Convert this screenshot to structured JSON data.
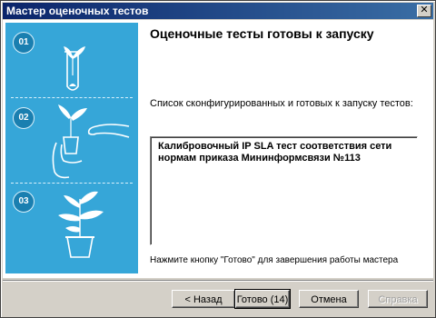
{
  "window": {
    "title": "Мастер оценочных тестов",
    "close_glyph": "✕"
  },
  "sidebar": {
    "steps": [
      {
        "number": "01",
        "icon": "test-tube-sprout-icon"
      },
      {
        "number": "02",
        "icon": "hand-planting-icon"
      },
      {
        "number": "03",
        "icon": "potted-plant-icon"
      }
    ],
    "colors": {
      "panel": "#36a6d8",
      "badge": "#1a7fb0",
      "line": "#d8f0fb"
    }
  },
  "main": {
    "heading": "Оценочные тесты готовы к запуску",
    "list_label": "Список сконфигурированных и готовых к запуску тестов:",
    "tests": [
      "Калибровочный IP SLA тест соответствия сети нормам приказа Мининформсвязи №113"
    ],
    "finish_text": "Нажмите кнопку \"Готово\" для завершения работы мастера"
  },
  "buttons": {
    "back": "< Назад",
    "finish": "Готово (14)",
    "cancel": "Отмена",
    "help": "Справка"
  },
  "colors": {
    "titlebar_start": "#0a246a",
    "titlebar_end": "#3a6ea5",
    "face": "#d4d0c8"
  }
}
